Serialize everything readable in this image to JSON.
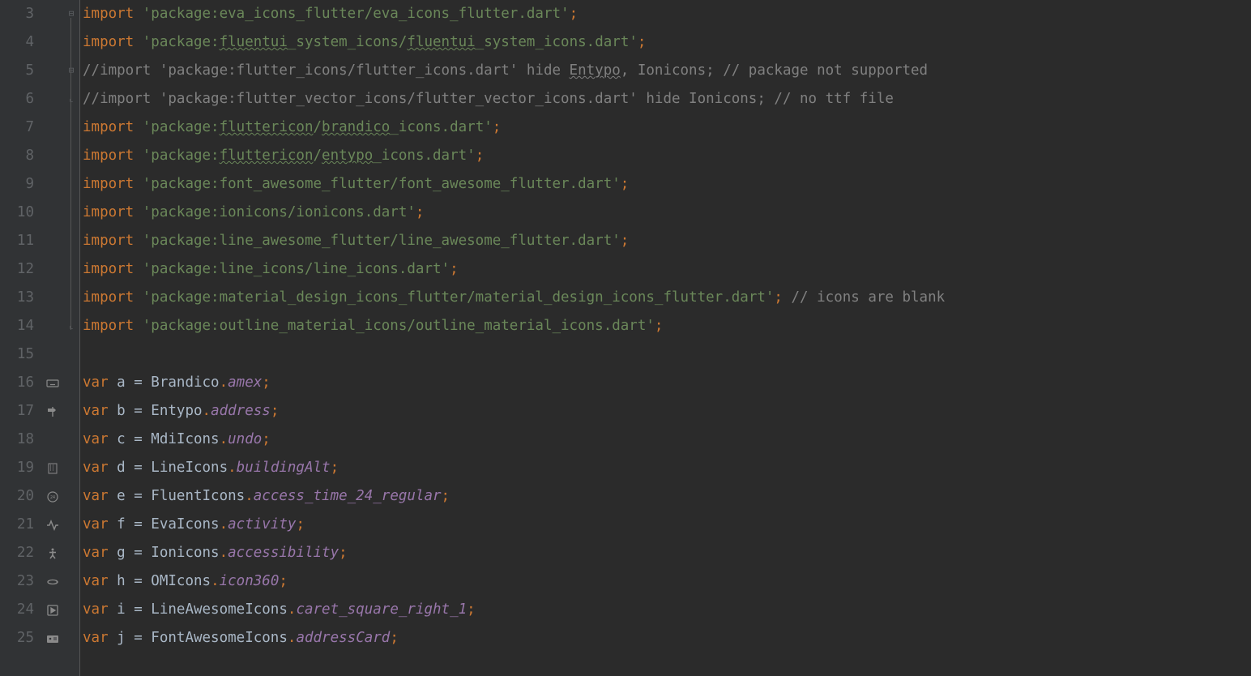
{
  "lines": [
    {
      "num": "3",
      "gutterIcon": "",
      "fold": "minus",
      "tokens": [
        [
          "kw",
          "import"
        ],
        [
          "plain",
          " "
        ],
        [
          "str",
          "'package:eva_icons_flutter/eva_icons_flutter.dart'"
        ],
        [
          "semi",
          ";"
        ]
      ]
    },
    {
      "num": "4",
      "gutterIcon": "",
      "fold": "",
      "tokens": [
        [
          "kw",
          "import"
        ],
        [
          "plain",
          " "
        ],
        [
          "str",
          "'package:"
        ],
        [
          "str-wavy",
          "fluentui"
        ],
        [
          "str",
          "_system_icons/"
        ],
        [
          "str-wavy",
          "fluentui"
        ],
        [
          "str",
          "_system_icons.dart'"
        ],
        [
          "semi",
          ";"
        ]
      ]
    },
    {
      "num": "5",
      "gutterIcon": "",
      "fold": "minus",
      "tokens": [
        [
          "comment",
          "//import 'package:flutter_icons/flutter_icons.dart' hide "
        ],
        [
          "comment-wavy",
          "Entypo"
        ],
        [
          "comment",
          ", Ionicons; // package not supported"
        ]
      ]
    },
    {
      "num": "6",
      "gutterIcon": "",
      "fold": "end",
      "tokens": [
        [
          "comment",
          "//import 'package:flutter_vector_icons/flutter_vector_icons.dart' hide Ionicons; // no ttf file"
        ]
      ]
    },
    {
      "num": "7",
      "gutterIcon": "",
      "fold": "",
      "tokens": [
        [
          "kw",
          "import"
        ],
        [
          "plain",
          " "
        ],
        [
          "str",
          "'package:"
        ],
        [
          "str-wavy",
          "fluttericon"
        ],
        [
          "str",
          "/"
        ],
        [
          "str-wavy",
          "brandico"
        ],
        [
          "str",
          "_icons.dart'"
        ],
        [
          "semi",
          ";"
        ]
      ]
    },
    {
      "num": "8",
      "gutterIcon": "",
      "fold": "",
      "tokens": [
        [
          "kw",
          "import"
        ],
        [
          "plain",
          " "
        ],
        [
          "str",
          "'package:"
        ],
        [
          "str-wavy",
          "fluttericon"
        ],
        [
          "str",
          "/"
        ],
        [
          "str-wavy",
          "entypo"
        ],
        [
          "str",
          "_icons.dart'"
        ],
        [
          "semi",
          ";"
        ]
      ]
    },
    {
      "num": "9",
      "gutterIcon": "",
      "fold": "",
      "tokens": [
        [
          "kw",
          "import"
        ],
        [
          "plain",
          " "
        ],
        [
          "str",
          "'package:font_awesome_flutter/font_awesome_flutter.dart'"
        ],
        [
          "semi",
          ";"
        ]
      ]
    },
    {
      "num": "10",
      "gutterIcon": "",
      "fold": "",
      "tokens": [
        [
          "kw",
          "import"
        ],
        [
          "plain",
          " "
        ],
        [
          "str",
          "'package:ionicons/ionicons.dart'"
        ],
        [
          "semi",
          ";"
        ]
      ]
    },
    {
      "num": "11",
      "gutterIcon": "",
      "fold": "",
      "tokens": [
        [
          "kw",
          "import"
        ],
        [
          "plain",
          " "
        ],
        [
          "str",
          "'package:line_awesome_flutter/line_awesome_flutter.dart'"
        ],
        [
          "semi",
          ";"
        ]
      ]
    },
    {
      "num": "12",
      "gutterIcon": "",
      "fold": "",
      "tokens": [
        [
          "kw",
          "import"
        ],
        [
          "plain",
          " "
        ],
        [
          "str",
          "'package:line_icons/line_icons.dart'"
        ],
        [
          "semi",
          ";"
        ]
      ]
    },
    {
      "num": "13",
      "gutterIcon": "",
      "fold": "",
      "tokens": [
        [
          "kw",
          "import"
        ],
        [
          "plain",
          " "
        ],
        [
          "str",
          "'package:material_design_icons_flutter/material_design_icons_flutter.dart'"
        ],
        [
          "semi",
          ";"
        ],
        [
          "plain",
          " "
        ],
        [
          "comment",
          "// icons are blank"
        ]
      ]
    },
    {
      "num": "14",
      "gutterIcon": "",
      "fold": "end",
      "tokens": [
        [
          "kw",
          "import"
        ],
        [
          "plain",
          " "
        ],
        [
          "str",
          "'package:outline_material_icons/outline_material_icons.dart'"
        ],
        [
          "semi",
          ";"
        ]
      ]
    },
    {
      "num": "15",
      "gutterIcon": "",
      "fold": "",
      "tokens": []
    },
    {
      "num": "16",
      "gutterIcon": "keyboard",
      "fold": "",
      "tokens": [
        [
          "kw",
          "var"
        ],
        [
          "plain",
          " a "
        ],
        [
          "eq",
          "="
        ],
        [
          "plain",
          " Brandico"
        ],
        [
          "punct",
          "."
        ],
        [
          "prop",
          "amex"
        ],
        [
          "semi",
          ";"
        ]
      ]
    },
    {
      "num": "17",
      "gutterIcon": "signpost",
      "fold": "",
      "tokens": [
        [
          "kw",
          "var"
        ],
        [
          "plain",
          " b "
        ],
        [
          "eq",
          "="
        ],
        [
          "plain",
          " Entypo"
        ],
        [
          "punct",
          "."
        ],
        [
          "prop",
          "address"
        ],
        [
          "semi",
          ";"
        ]
      ]
    },
    {
      "num": "18",
      "gutterIcon": "",
      "fold": "",
      "tokens": [
        [
          "kw",
          "var"
        ],
        [
          "plain",
          " c "
        ],
        [
          "eq",
          "="
        ],
        [
          "plain",
          " MdiIcons"
        ],
        [
          "punct",
          "."
        ],
        [
          "prop",
          "undo"
        ],
        [
          "semi",
          ";"
        ]
      ]
    },
    {
      "num": "19",
      "gutterIcon": "building",
      "fold": "",
      "tokens": [
        [
          "kw",
          "var"
        ],
        [
          "plain",
          " d "
        ],
        [
          "eq",
          "="
        ],
        [
          "plain",
          " LineIcons"
        ],
        [
          "punct",
          "."
        ],
        [
          "prop",
          "buildingAlt"
        ],
        [
          "semi",
          ";"
        ]
      ]
    },
    {
      "num": "20",
      "gutterIcon": "clock24",
      "fold": "",
      "tokens": [
        [
          "kw",
          "var"
        ],
        [
          "plain",
          " e "
        ],
        [
          "eq",
          "="
        ],
        [
          "plain",
          " FluentIcons"
        ],
        [
          "punct",
          "."
        ],
        [
          "prop",
          "access_time_24_regular"
        ],
        [
          "semi",
          ";"
        ]
      ]
    },
    {
      "num": "21",
      "gutterIcon": "activity",
      "fold": "",
      "tokens": [
        [
          "kw",
          "var"
        ],
        [
          "plain",
          " f "
        ],
        [
          "eq",
          "="
        ],
        [
          "plain",
          " EvaIcons"
        ],
        [
          "punct",
          "."
        ],
        [
          "prop",
          "activity"
        ],
        [
          "semi",
          ";"
        ]
      ]
    },
    {
      "num": "22",
      "gutterIcon": "person",
      "fold": "",
      "tokens": [
        [
          "kw",
          "var"
        ],
        [
          "plain",
          " g "
        ],
        [
          "eq",
          "="
        ],
        [
          "plain",
          " Ionicons"
        ],
        [
          "punct",
          "."
        ],
        [
          "prop",
          "accessibility"
        ],
        [
          "semi",
          ";"
        ]
      ]
    },
    {
      "num": "23",
      "gutterIcon": "rotate",
      "fold": "",
      "tokens": [
        [
          "kw",
          "var"
        ],
        [
          "plain",
          " h "
        ],
        [
          "eq",
          "="
        ],
        [
          "plain",
          " OMIcons"
        ],
        [
          "punct",
          "."
        ],
        [
          "prop",
          "icon360"
        ],
        [
          "semi",
          ";"
        ]
      ]
    },
    {
      "num": "24",
      "gutterIcon": "caret",
      "fold": "",
      "tokens": [
        [
          "kw",
          "var"
        ],
        [
          "plain",
          " i "
        ],
        [
          "eq",
          "="
        ],
        [
          "plain",
          " LineAwesomeIcons"
        ],
        [
          "punct",
          "."
        ],
        [
          "prop",
          "caret_square_right_1"
        ],
        [
          "semi",
          ";"
        ]
      ]
    },
    {
      "num": "25",
      "gutterIcon": "idcard",
      "fold": "",
      "tokens": [
        [
          "kw",
          "var"
        ],
        [
          "plain",
          " j "
        ],
        [
          "eq",
          "="
        ],
        [
          "plain",
          " FontAwesomeIcons"
        ],
        [
          "punct",
          "."
        ],
        [
          "prop",
          "addressCard"
        ],
        [
          "semi",
          ";"
        ]
      ]
    }
  ],
  "icons": {
    "keyboard": "keyboard-icon",
    "signpost": "signpost-icon",
    "building": "building-icon",
    "clock24": "clock-24-icon",
    "activity": "activity-icon",
    "person": "accessibility-icon",
    "rotate": "rotate-360-icon",
    "caret": "caret-square-right-icon",
    "idcard": "address-card-icon"
  }
}
